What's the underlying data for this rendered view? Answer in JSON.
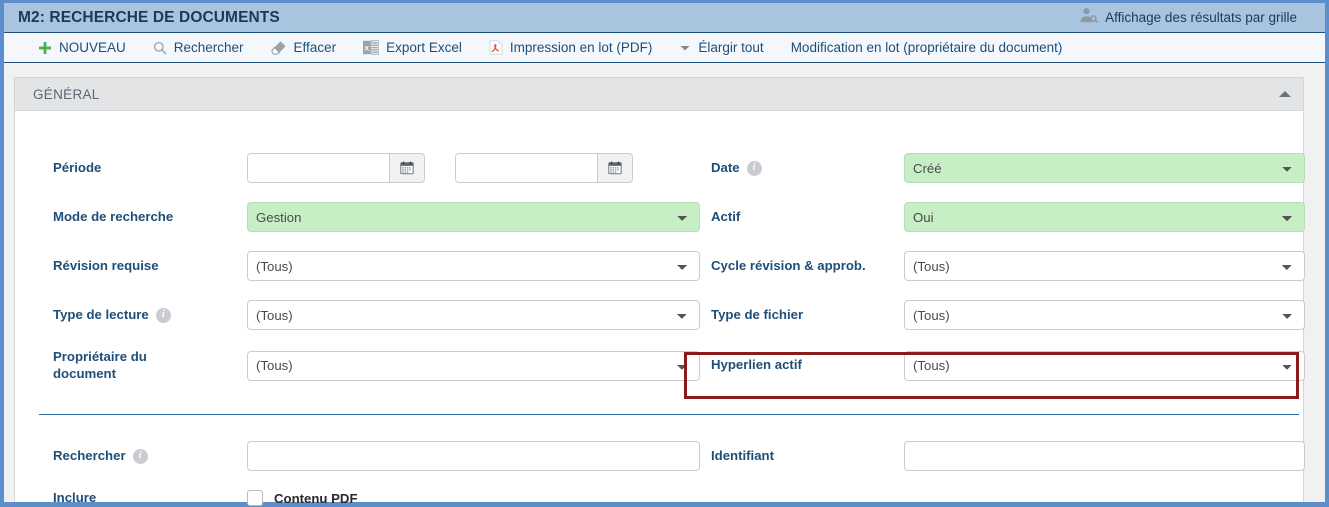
{
  "window": {
    "title": "M2: RECHERCHE DE DOCUMENTS",
    "view_mode_label": "Affichage des résultats par grille",
    "view_mode_icon": "user-search-icon",
    "accent_color": "#5b8ecb",
    "titlebar_color": "#a8c4de"
  },
  "toolbar": {
    "items": [
      {
        "label": "NOUVEAU",
        "icon": "plus-icon"
      },
      {
        "label": "Rechercher",
        "icon": "search-icon"
      },
      {
        "label": "Effacer",
        "icon": "eraser-icon"
      },
      {
        "label": "Export Excel",
        "icon": "excel-icon"
      },
      {
        "label": "Impression en lot (PDF)",
        "icon": "pdf-icon"
      },
      {
        "label": "Élargir tout",
        "icon": "chevron-down-icon"
      },
      {
        "label": "Modification en lot (propriétaire du document)",
        "icon": "none"
      }
    ]
  },
  "panel": {
    "title": "GÉNÉRAL",
    "collapse_icon": "triangle-up-icon",
    "fields": {
      "periode": {
        "label": "Période",
        "start_value": "",
        "end_value": "",
        "start_placeholder": "",
        "end_placeholder": "",
        "calendar_icon": "calendar-icon"
      },
      "date": {
        "label": "Date",
        "value": "Créé",
        "info_icon": "info-icon",
        "highlight": "#c6efc6",
        "options": [
          "Créé"
        ]
      },
      "mode_de_recherche": {
        "label": "Mode de recherche",
        "value": "Gestion",
        "highlight": "#c6efc6",
        "options": [
          "Gestion"
        ]
      },
      "actif": {
        "label": "Actif",
        "value": "Oui",
        "highlight": "#c6efc6",
        "options": [
          "Oui"
        ]
      },
      "revision_requise": {
        "label": "Révision requise",
        "value": "(Tous)",
        "options": [
          "(Tous)"
        ]
      },
      "cycle_revision": {
        "label": "Cycle révision & approb.",
        "value": "(Tous)",
        "options": [
          "(Tous)"
        ]
      },
      "type_de_lecture": {
        "label": "Type de lecture",
        "value": "(Tous)",
        "info_icon": "info-icon",
        "options": [
          "(Tous)"
        ]
      },
      "type_de_fichier": {
        "label": "Type de fichier",
        "value": "(Tous)",
        "options": [
          "(Tous)"
        ]
      },
      "proprietaire": {
        "label": "Propriétaire du document",
        "value": "(Tous)",
        "options": [
          "(Tous)"
        ]
      },
      "hyperlien_actif": {
        "label": "Hyperlien actif",
        "value": "(Tous)",
        "options": [
          "(Tous)"
        ],
        "highlight_border": "#8b1a1a"
      },
      "rechercher": {
        "label": "Rechercher",
        "value": "",
        "placeholder": "",
        "info_icon": "info-icon"
      },
      "identifiant": {
        "label": "Identifiant",
        "value": "",
        "placeholder": ""
      },
      "inclure": {
        "label": "Inclure",
        "checkbox_label": "Contenu PDF",
        "checked": false
      }
    }
  }
}
